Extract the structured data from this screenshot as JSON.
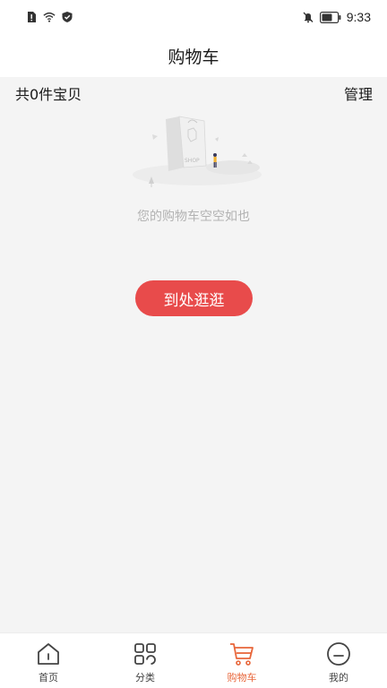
{
  "status_bar": {
    "time": "9:33",
    "left_icons": [
      "alert-icon",
      "wifi-icon",
      "shield-icon"
    ],
    "right_icons": [
      "mute-bell-icon",
      "battery-icon"
    ]
  },
  "header": {
    "title": "购物车"
  },
  "summary": {
    "item_count": "共0件宝贝",
    "manage_label": "管理"
  },
  "empty_state": {
    "illustration_icon": "shopping-bag-illustration",
    "message": "您的购物车空空如也",
    "button_label": "到处逛逛"
  },
  "bottom_nav": {
    "items": [
      {
        "label": "首页",
        "icon": "home-icon",
        "active": false
      },
      {
        "label": "分类",
        "icon": "category-icon",
        "active": false
      },
      {
        "label": "购物车",
        "icon": "cart-icon",
        "active": true
      },
      {
        "label": "我的",
        "icon": "profile-icon",
        "active": false
      }
    ]
  },
  "colors": {
    "accent": "#e84b4b",
    "active_nav": "#e8663a",
    "background": "#f4f4f4"
  }
}
